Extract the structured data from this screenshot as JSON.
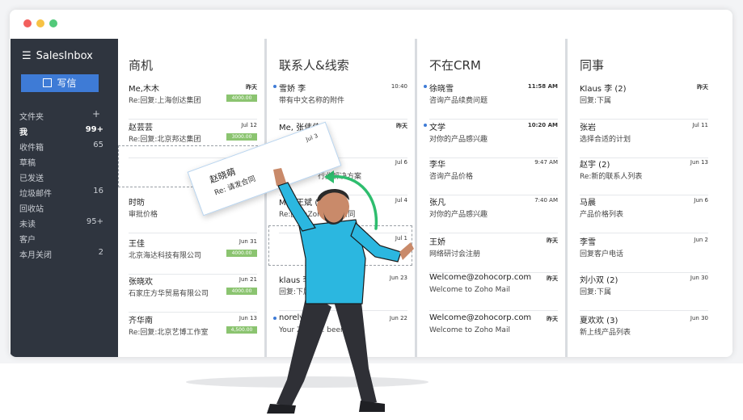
{
  "app": {
    "name": "SalesInbox",
    "compose_label": "写信"
  },
  "sidebar": {
    "folders_header": "文件夹",
    "folders_add": "+",
    "items": [
      {
        "label": "我",
        "count": "99+",
        "active": true
      },
      {
        "label": "收件箱",
        "count": "65"
      },
      {
        "label": "草稿",
        "count": ""
      },
      {
        "label": "已发送",
        "count": ""
      },
      {
        "label": "垃圾邮件",
        "count": "16"
      },
      {
        "label": "回收站",
        "count": ""
      },
      {
        "label": "未读",
        "count": "95+"
      },
      {
        "label": "客户",
        "count": ""
      },
      {
        "label": "本月关闭",
        "count": "2"
      }
    ]
  },
  "columns": [
    {
      "title": "商机",
      "items": [
        {
          "from": "Me,木木",
          "subject": "Re:回复:上海创达集团",
          "time": "昨天",
          "tag": "4000.00"
        },
        {
          "from": "赵芸芸",
          "subject": "Re:回复:北京邦达集团",
          "time": "Jul 12",
          "tag": "3000.00"
        },
        {
          "from": "时昉",
          "subject": "审批价格",
          "time": "",
          "tag": ""
        },
        {
          "from": "王佳",
          "subject": "北京海达科技有限公司",
          "time": "Jun 31",
          "tag": "4000.00"
        },
        {
          "from": "张晓欢",
          "subject": "石家庄方华贸易有限公司",
          "time": "Jun 21",
          "tag": "4000.00"
        },
        {
          "from": "齐华南",
          "subject": "Re:回复:北京艺博工作室",
          "time": "Jun 13",
          "tag": "4,500.00"
        }
      ]
    },
    {
      "title": "联系人&线索",
      "items": [
        {
          "from": "雪娇 李",
          "subject": "带有中文名称的附件",
          "time": "10:40",
          "unread": true
        },
        {
          "from": "Me, 张伟伟",
          "subject": "",
          "time": "昨天"
        },
        {
          "from": "",
          "subject": "行业解决方案",
          "time": "Jul 6"
        },
        {
          "from": "Me, 王斌 (2)",
          "subject": "Re:回复:Zoho服务合同",
          "time": "Jul 4"
        },
        {
          "from": "",
          "subject": "",
          "time": "Jul 1"
        },
        {
          "from": "klaus 李",
          "subject": "回复:下属",
          "time": "Jun 23"
        },
        {
          "from": "norely",
          "subject": "Your Zoho ... been",
          "time": "Jun 22",
          "unread": true
        }
      ]
    },
    {
      "title": "不在CRM",
      "items": [
        {
          "from": "徐晓雪",
          "subject": "咨询产品续费问题",
          "time": "11:58 AM",
          "unread": true
        },
        {
          "from": "文学",
          "subject": "对你的产品感兴趣",
          "time": "10:20 AM",
          "unread": true
        },
        {
          "from": "李华",
          "subject": "咨询产品价格",
          "time": "9:47 AM"
        },
        {
          "from": "张凡",
          "subject": "对你的产品感兴趣",
          "time": "7:40 AM"
        },
        {
          "from": "王娇",
          "subject": "网络研讨会注册",
          "time": "昨天"
        },
        {
          "from": "Welcome@zohocorp.com",
          "subject": "Welcome to Zoho Mail",
          "time": "昨天"
        },
        {
          "from": "Welcome@zohocorp.com",
          "subject": "Welcome to Zoho Mail",
          "time": "昨天"
        }
      ]
    },
    {
      "title": "同事",
      "items": [
        {
          "from": "Klaus 李 (2)",
          "subject": "回复:下属",
          "time": "昨天"
        },
        {
          "from": "张岩",
          "subject": "选择合适的计划",
          "time": "Jul 11"
        },
        {
          "from": "赵宇 (2)",
          "subject": "Re:新的联系人列表",
          "time": "Jun 13"
        },
        {
          "from": "马晨",
          "subject": "产品价格列表",
          "time": "Jun 6"
        },
        {
          "from": "李雪",
          "subject": "回复客户电话",
          "time": "Jun 2"
        },
        {
          "from": "刘小双 (2)",
          "subject": "回复:下属",
          "time": "Jun 30"
        },
        {
          "from": "夏欢欢 (3)",
          "subject": "新上线产品列表",
          "time": "Jun 30"
        }
      ]
    }
  ],
  "drag_card": {
    "name": "赵晓萌",
    "subject": "Re: 请发合同",
    "time": "Jul 3"
  },
  "colors": {
    "sidebar": "#2f353f",
    "accent": "#3e7bd6",
    "tag": "#8bc470",
    "arrow": "#2ebd6e",
    "shirt": "#2bb7e0"
  },
  "icons": {
    "menu": "hamburger-icon",
    "compose": "compose-icon",
    "add": "plus-icon"
  }
}
